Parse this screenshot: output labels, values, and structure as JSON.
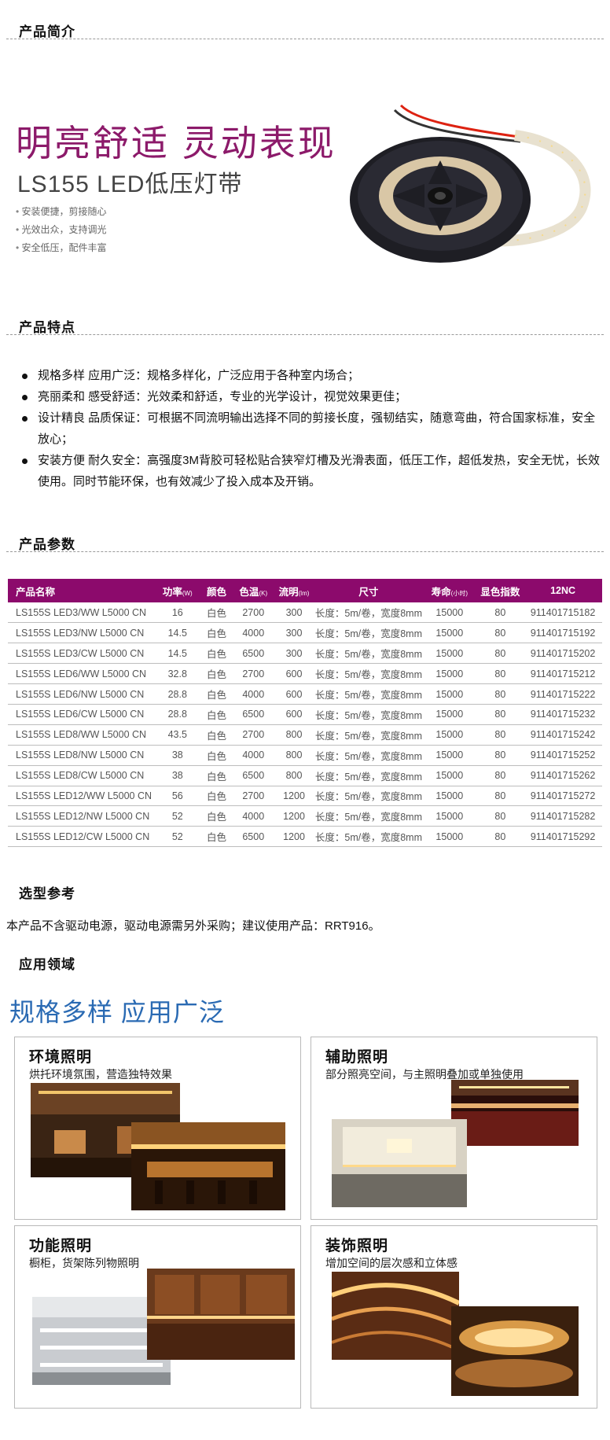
{
  "sections": {
    "intro": "产品简介",
    "features": "产品特点",
    "params": "产品参数",
    "selection": "选型参考",
    "application": "应用领域"
  },
  "hero": {
    "headline": "明亮舒适 灵动表现",
    "product": "LS155 LED低压灯带",
    "bullets": [
      "安装便捷，剪接随心",
      "光效出众，支持调光",
      "安全低压，配件丰富"
    ]
  },
  "features": [
    "规格多样 应用广泛：规格多样化，广泛应用于各种室内场合；",
    "亮丽柔和 感受舒适：光效柔和舒适，专业的光学设计，视觉效果更佳；",
    "设计精良 品质保证：可根据不同流明输出选择不同的剪接长度，强韧结实，随意弯曲，符合国家标准，安全放心；",
    "安装方便 耐久安全：高强度3M背胶可轻松贴合狭窄灯槽及光滑表面，低压工作，超低发热，安全无忧，长效使用。同时节能环保，也有效减少了投入成本及开销。"
  ],
  "table": {
    "headers": [
      {
        "label": "产品名称",
        "unit": ""
      },
      {
        "label": "功率",
        "unit": "(W)"
      },
      {
        "label": "颜色",
        "unit": ""
      },
      {
        "label": "色温",
        "unit": "(K)"
      },
      {
        "label": "流明",
        "unit": "(lm)"
      },
      {
        "label": "尺寸",
        "unit": ""
      },
      {
        "label": "寿命",
        "unit": "(小时)"
      },
      {
        "label": "显色指数",
        "unit": ""
      },
      {
        "label": "12NC",
        "unit": ""
      }
    ],
    "rows": [
      [
        "LS155S LED3/WW L5000 CN",
        "16",
        "白色",
        "2700",
        "300",
        "长度：5m/卷，宽度8mm",
        "15000",
        "80",
        "911401715182"
      ],
      [
        "LS155S LED3/NW L5000 CN",
        "14.5",
        "白色",
        "4000",
        "300",
        "长度：5m/卷，宽度8mm",
        "15000",
        "80",
        "911401715192"
      ],
      [
        "LS155S LED3/CW L5000 CN",
        "14.5",
        "白色",
        "6500",
        "300",
        "长度：5m/卷，宽度8mm",
        "15000",
        "80",
        "911401715202"
      ],
      [
        "LS155S LED6/WW L5000 CN",
        "32.8",
        "白色",
        "2700",
        "600",
        "长度：5m/卷，宽度8mm",
        "15000",
        "80",
        "911401715212"
      ],
      [
        "LS155S LED6/NW L5000 CN",
        "28.8",
        "白色",
        "4000",
        "600",
        "长度：5m/卷，宽度8mm",
        "15000",
        "80",
        "911401715222"
      ],
      [
        "LS155S LED6/CW L5000 CN",
        "28.8",
        "白色",
        "6500",
        "600",
        "长度：5m/卷，宽度8mm",
        "15000",
        "80",
        "911401715232"
      ],
      [
        "LS155S LED8/WW L5000 CN",
        "43.5",
        "白色",
        "2700",
        "800",
        "长度：5m/卷，宽度8mm",
        "15000",
        "80",
        "911401715242"
      ],
      [
        "LS155S LED8/NW L5000 CN",
        "38",
        "白色",
        "4000",
        "800",
        "长度：5m/卷，宽度8mm",
        "15000",
        "80",
        "911401715252"
      ],
      [
        "LS155S LED8/CW L5000 CN",
        "38",
        "白色",
        "6500",
        "800",
        "长度：5m/卷，宽度8mm",
        "15000",
        "80",
        "911401715262"
      ],
      [
        "LS155S LED12/WW L5000 CN",
        "56",
        "白色",
        "2700",
        "1200",
        "长度：5m/卷，宽度8mm",
        "15000",
        "80",
        "911401715272"
      ],
      [
        "LS155S LED12/NW L5000 CN",
        "52",
        "白色",
        "4000",
        "1200",
        "长度：5m/卷，宽度8mm",
        "15000",
        "80",
        "911401715282"
      ],
      [
        "LS155S LED12/CW L5000 CN",
        "52",
        "白色",
        "6500",
        "1200",
        "长度：5m/卷，宽度8mm",
        "15000",
        "80",
        "911401715292"
      ]
    ]
  },
  "selection_text": "本产品不含驱动电源，驱动电源需另外采购；建议使用产品：RRT916。",
  "application": {
    "title": "规格多样 应用广泛",
    "cards": [
      {
        "title": "环境照明",
        "desc": "烘托环境氛围，营造独特效果"
      },
      {
        "title": "辅助照明",
        "desc": "部分照亮空间，与主照明叠加或单独使用"
      },
      {
        "title": "功能照明",
        "desc": "橱柜，货架陈列物照明"
      },
      {
        "title": "装饰照明",
        "desc": "增加空间的层次感和立体感"
      }
    ]
  },
  "colors": {
    "brand_purple": "#8c0a6c",
    "headline_purple": "#8c1a6a",
    "app_blue": "#2a6ab3"
  }
}
